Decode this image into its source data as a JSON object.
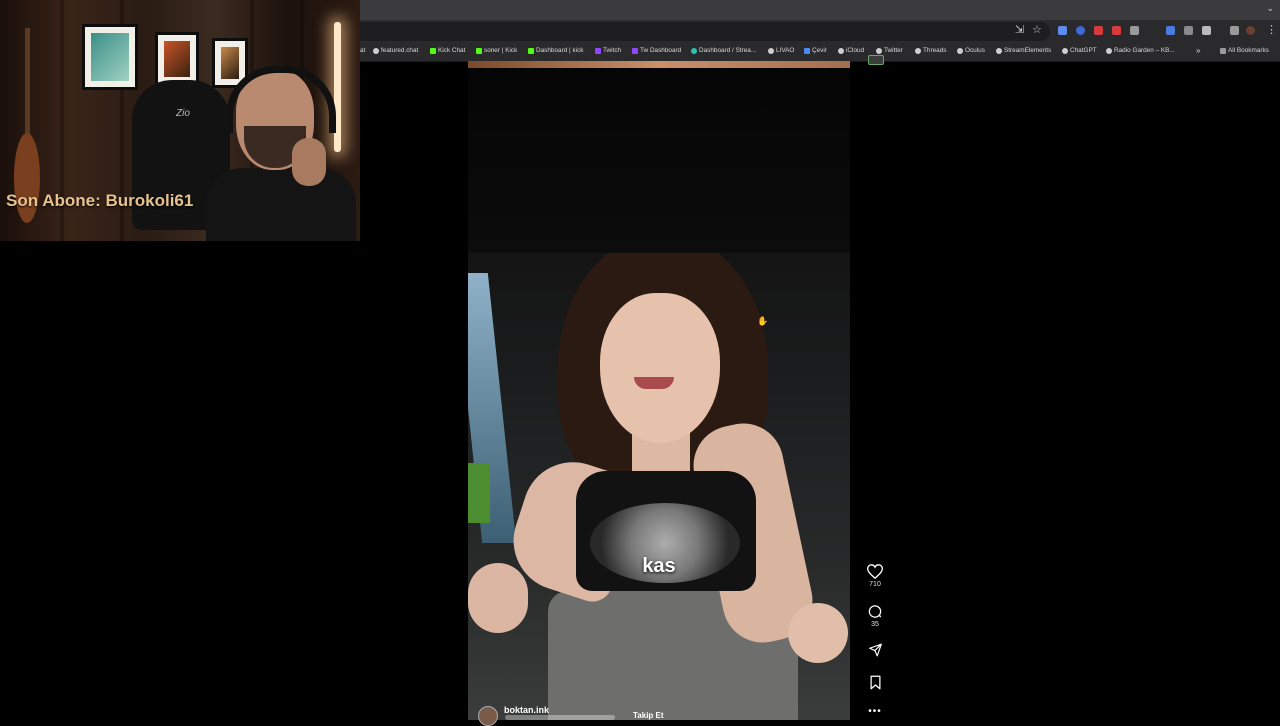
{
  "webcam": {
    "subscriber_text": "Son Abone: Burokoli61",
    "chair_logo": "Zio"
  },
  "browser": {
    "bookmarks": [
      {
        "label": "at",
        "color": "#cfcfcf"
      },
      {
        "label": "featured.chat",
        "color": "#cfcfcf"
      },
      {
        "label": "Kick Chat",
        "color": "#53fc18"
      },
      {
        "label": "soner | Kick",
        "color": "#53fc18"
      },
      {
        "label": "Dashboard | kick",
        "color": "#53fc18"
      },
      {
        "label": "Twitch",
        "color": "#9146ff"
      },
      {
        "label": "Tw Dashboard",
        "color": "#9146ff"
      },
      {
        "label": "Dashboard / Strea...",
        "color": "#2cc4b5"
      },
      {
        "label": "LIVAO",
        "color": "#cfcfcf"
      },
      {
        "label": "Çevir",
        "color": "#4b8bf5"
      },
      {
        "label": "iCloud",
        "color": "#cfcfcf"
      },
      {
        "label": "Twitter",
        "color": "#cfcfcf"
      },
      {
        "label": "Threads",
        "color": "#cfcfcf"
      },
      {
        "label": "Oculus",
        "color": "#cfcfcf"
      },
      {
        "label": "StreamElements",
        "color": "#cfcfcf"
      },
      {
        "label": "ChatGPT",
        "color": "#cfcfcf"
      },
      {
        "label": "Radio Garden – KB...",
        "color": "#cfcfcf"
      }
    ],
    "overflow_label": "»",
    "all_bookmarks": "All Bookmarks"
  },
  "reel": {
    "caption": "kas",
    "username": "boktan.ink",
    "follow_label": "Takip Et",
    "likes": "710",
    "comments": "35"
  },
  "colors": {
    "accent_kick": "#53fc18",
    "accent_twitch": "#9146ff",
    "subscriber_text": "#e7c28c"
  }
}
